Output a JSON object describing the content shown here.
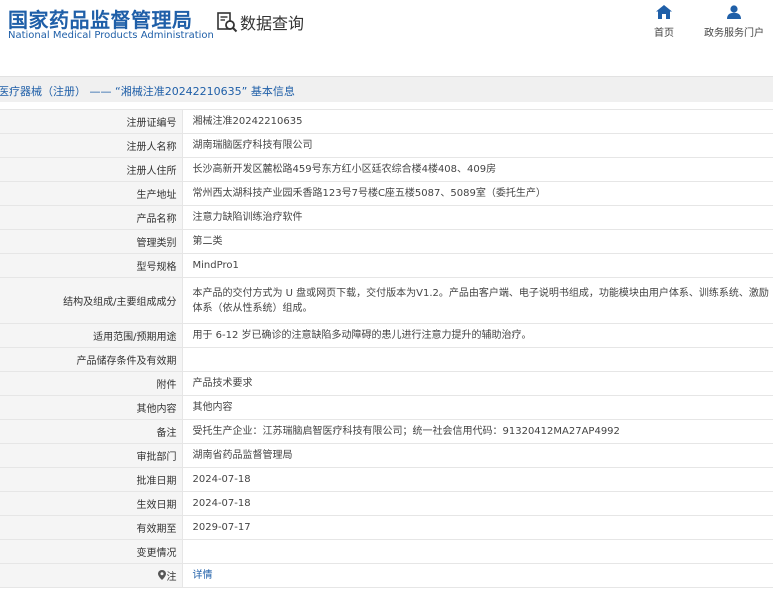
{
  "header": {
    "logo_cn": "国家药品监督管理局",
    "logo_en": "National Medical Products Administration",
    "query_title": "数据查询",
    "nav": [
      {
        "label": "首页",
        "icon": "home-icon"
      },
      {
        "label": "政务服务门户",
        "icon": "user-icon"
      }
    ]
  },
  "colors": {
    "brand": "#1f5fa8",
    "label_bg": "#f5f5f5",
    "title_bar_bg": "#f0f0f0"
  },
  "title": "医疗器械（注册） —— “湘械注准20242210635” 基本信息",
  "rows": [
    {
      "label": "注册证编号",
      "value": "湘械注准20242210635"
    },
    {
      "label": "注册人名称",
      "value": "湖南瑞脑医疗科技有限公司"
    },
    {
      "label": "注册人住所",
      "value": "长沙高新开发区麓松路459号东方红小区廷农综合楼4楼408、409房"
    },
    {
      "label": "生产地址",
      "value": "常州西太湖科技产业园禾香路123号7号楼C座五楼5087、5089室（委托生产）"
    },
    {
      "label": "产品名称",
      "value": "注意力缺陷训练治疗软件"
    },
    {
      "label": "管理类别",
      "value": "第二类"
    },
    {
      "label": "型号规格",
      "value": "MindPro1"
    },
    {
      "label": "结构及组成/主要组成成分",
      "value": "本产品的交付方式为 U 盘或网页下载，交付版本为V1.2。产品由客户端、电子说明书组成，功能模块由用户体系、训练系统、激励体系（依从性系统）组成。"
    },
    {
      "label": "适用范围/预期用途",
      "value": "用于 6-12 岁已确诊的注意缺陷多动障碍的患儿进行注意力提升的辅助治疗。"
    },
    {
      "label": "产品储存条件及有效期",
      "value": ""
    },
    {
      "label": "附件",
      "value": "产品技术要求"
    },
    {
      "label": "其他内容",
      "value": "其他内容"
    },
    {
      "label": "备注",
      "value": "受托生产企业：江苏瑞脑启智医疗科技有限公司；统一社会信用代码：91320412MA27AP4992"
    },
    {
      "label": "审批部门",
      "value": "湖南省药品监督管理局"
    },
    {
      "label": "批准日期",
      "value": "2024-07-18"
    },
    {
      "label": "生效日期",
      "value": "2024-07-18"
    },
    {
      "label": "有效期至",
      "value": "2029-07-17"
    },
    {
      "label": "变更情况",
      "value": ""
    }
  ],
  "note": {
    "label": "注",
    "link_text": "详情",
    "icon": "pin-icon"
  }
}
